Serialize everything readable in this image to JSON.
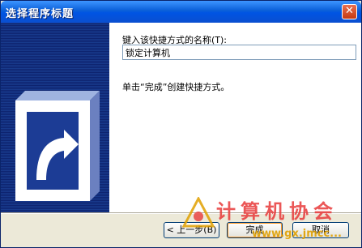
{
  "window": {
    "title": "选择程序标题",
    "close_glyph": "✕"
  },
  "content": {
    "prompt_label": "键入该快捷方式的名称(T):",
    "input_value": "锁定计算机",
    "finish_text": "单击“完成”创建快捷方式。"
  },
  "buttons": {
    "back": "< 上一步(B)",
    "finish": "完成",
    "cancel": "取消"
  },
  "watermark": {
    "chinese": "计算机协会",
    "url": "www.gx.jmcc..."
  },
  "colors": {
    "title_bar": "#0054e3",
    "left_panel": "#183a8c",
    "content_bg": "#ffffff",
    "window_bg": "#ece9d8",
    "close_button": "#c43a12",
    "watermark_red": "#e83a3a"
  },
  "icons": {
    "close": "close-icon",
    "shortcut_illustration": "shortcut-arrow-icon"
  }
}
